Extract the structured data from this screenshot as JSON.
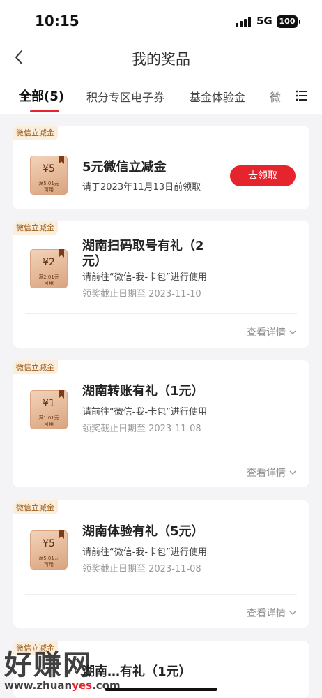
{
  "status": {
    "time": "10:15",
    "network": "5G",
    "battery": "100"
  },
  "nav": {
    "title": "我的奖品"
  },
  "tabs": [
    {
      "label": "全部(5)",
      "active": true
    },
    {
      "label": "积分专区电子券"
    },
    {
      "label": "基金体验金"
    },
    {
      "label": "微"
    }
  ],
  "cards": [
    {
      "tag": "微信立减金",
      "coupon_amount": "¥5",
      "coupon_condition": "满5.01元\n可用",
      "title": "5元微信立减金",
      "subtitle": "请于2023年11月13日前领取",
      "button": "去领取"
    },
    {
      "tag": "微信立减金",
      "coupon_amount": "¥2",
      "coupon_condition": "满2.01元\n可用",
      "title": "湖南扫码取号有礼（2元）",
      "subtitle": "请前往“微信-我-卡包”进行使用",
      "deadline": "领奖截止日期至 2023-11-10",
      "detail": "查看详情"
    },
    {
      "tag": "微信立减金",
      "coupon_amount": "¥1",
      "coupon_condition": "满1.01元\n可用",
      "title": "湖南转账有礼（1元）",
      "subtitle": "请前往“微信-我-卡包”进行使用",
      "deadline": "领奖截止日期至 2023-11-08",
      "detail": "查看详情"
    },
    {
      "tag": "微信立减金",
      "coupon_amount": "¥5",
      "coupon_condition": "满5.01元\n可用",
      "title": "湖南体验有礼（5元）",
      "subtitle": "请前往“微信-我-卡包”进行使用",
      "deadline": "领奖截止日期至 2023-11-08",
      "detail": "查看详情"
    },
    {
      "tag": "微信立减金",
      "title": "湖南…有礼（1元）"
    }
  ],
  "watermark": {
    "main": "好赚网",
    "url_pre": "www.zhuan",
    "url_red": "yes",
    "url_post": ".com"
  }
}
